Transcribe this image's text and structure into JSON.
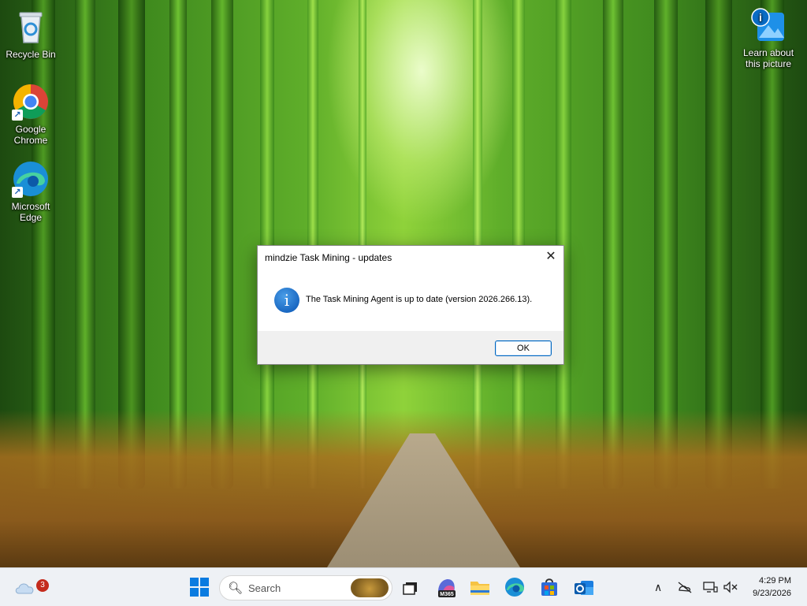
{
  "desktop": {
    "icons": [
      {
        "label": "Recycle Bin"
      },
      {
        "label": "Google Chrome"
      },
      {
        "label": "Microsoft Edge"
      },
      {
        "label": "Learn about this picture"
      }
    ]
  },
  "dialog": {
    "title": "mindzie Task Mining - updates",
    "close_glyph": "✕",
    "icon": "info-icon",
    "icon_glyph": "i",
    "message": "The Task Mining Agent is up to date (version 2026.266.13).",
    "ok_label": "OK"
  },
  "taskbar": {
    "weather_badge": "3",
    "search_placeholder": "Search",
    "m365_label": "M365",
    "clock_time": "4:29 PM",
    "clock_date": "9/23/2026",
    "pinned": [
      "start-button",
      "task-view",
      "microsoft-365-copilot",
      "file-explorer",
      "microsoft-edge",
      "microsoft-store",
      "outlook"
    ]
  },
  "colors": {
    "accent": "#0067c0",
    "badge": "#c42b1c",
    "taskbar_bg": "#eef1f5"
  }
}
